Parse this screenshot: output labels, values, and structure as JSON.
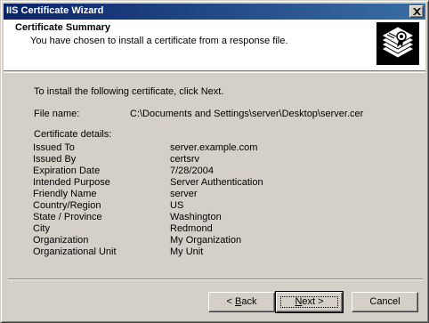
{
  "window": {
    "title": "IIS Certificate Wizard"
  },
  "header": {
    "title": "Certificate Summary",
    "subtitle": "You have chosen to install a certificate from a response file.",
    "icon": "certificate-wizard-icon"
  },
  "body": {
    "intro": "To install the following certificate, click Next.",
    "file_label": "File name:",
    "file_value": "C:\\Documents and Settings\\server\\Desktop\\server.cer",
    "details_label": "Certificate details:",
    "details": [
      {
        "key": "Issued To",
        "value": "server.example.com"
      },
      {
        "key": "Issued By",
        "value": "certsrv"
      },
      {
        "key": "Expiration Date",
        "value": "7/28/2004"
      },
      {
        "key": "Intended Purpose",
        "value": "Server Authentication"
      },
      {
        "key": "Friendly Name",
        "value": "server"
      },
      {
        "key": "Country/Region",
        "value": "US"
      },
      {
        "key": "State / Province",
        "value": "Washington"
      },
      {
        "key": "City",
        "value": "Redmond"
      },
      {
        "key": "Organization",
        "value": "My Organization"
      },
      {
        "key": "Organizational Unit",
        "value": "My Unit"
      }
    ]
  },
  "buttons": {
    "back": {
      "prefix": "< ",
      "accel": "B",
      "rest": "ack"
    },
    "next": {
      "accel": "N",
      "rest": "ext >"
    },
    "cancel": "Cancel"
  },
  "colors": {
    "titlebar_start": "#0a246a",
    "titlebar_end": "#3a6ea5",
    "dialog_bg": "#d4d0c8"
  }
}
